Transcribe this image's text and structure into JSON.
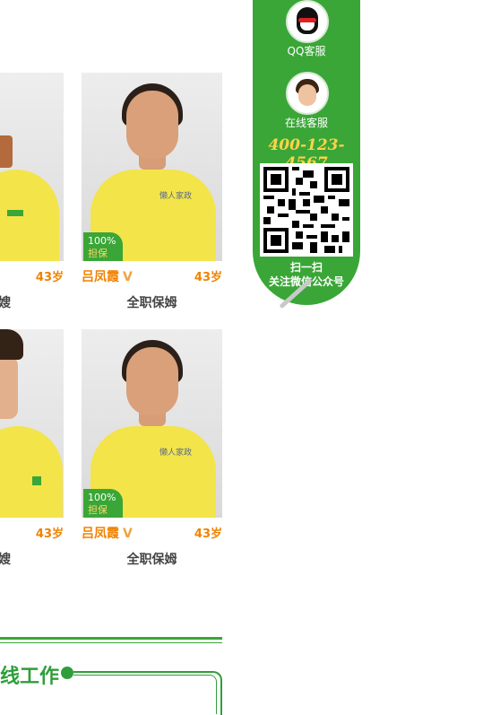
{
  "cards": [
    {
      "name": "吕凤霞",
      "age": "43岁",
      "job": "全职保姆",
      "badge_top": "100%",
      "badge_bottom": "担保",
      "shirt_text": "懒人家政"
    },
    {
      "name": "吕凤霞",
      "age": "43岁",
      "job": "全职保姆",
      "badge_top": "100%",
      "badge_bottom": "担保",
      "shirt_text": "懒人家政"
    }
  ],
  "left_cards": [
    {
      "age": "43岁",
      "job_tail": "嫂"
    },
    {
      "age": "43岁",
      "job_tail": "嫂"
    }
  ],
  "section": {
    "title_tail": "线工作"
  },
  "service": {
    "qq_label": "QQ客服",
    "agent_label": "在线客服",
    "phone": "400-123-4567",
    "scan_line1": "扫一扫",
    "scan_line2": "关注微信公众号"
  },
  "colors": {
    "brand_green": "#3aa637",
    "accent_orange": "#f08200",
    "phone_yellow": "#ffd34a"
  }
}
